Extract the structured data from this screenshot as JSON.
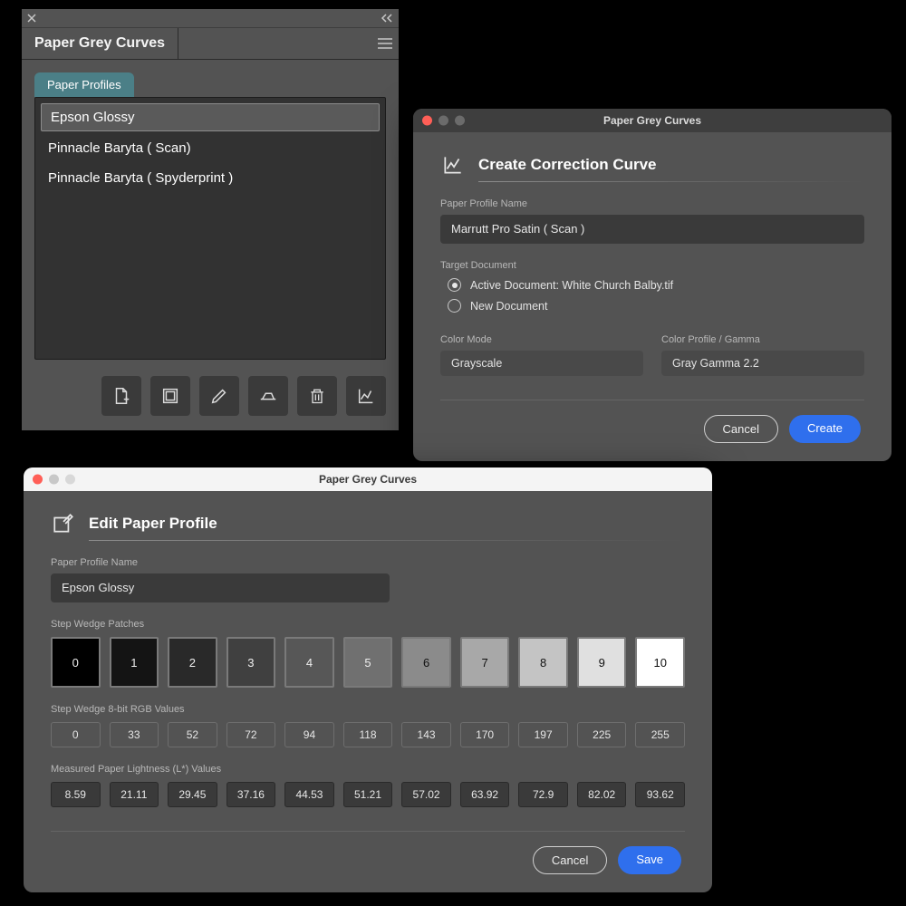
{
  "panel": {
    "title": "Paper Grey Curves",
    "tab_label": "Paper Profiles",
    "profiles": [
      "Epson Glossy",
      "Pinnacle Baryta ( Scan)",
      "Pinnacle Baryta ( Spyderprint )"
    ],
    "selected_index": 0
  },
  "create_dialog": {
    "window_title": "Paper Grey Curves",
    "heading": "Create Correction Curve",
    "profile_name_label": "Paper Profile Name",
    "profile_name_value": "Marrutt Pro Satin ( Scan )",
    "target_doc_label": "Target Document",
    "radio_active": "Active Document: White Church Balby.tif",
    "radio_new": "New Document",
    "color_mode_label": "Color Mode",
    "color_mode_value": "Grayscale",
    "color_profile_label": "Color Profile / Gamma",
    "color_profile_value": "Gray Gamma 2.2",
    "cancel_label": "Cancel",
    "create_label": "Create"
  },
  "edit_dialog": {
    "window_title": "Paper Grey Curves",
    "heading": "Edit Paper Profile",
    "profile_name_label": "Paper Profile Name",
    "profile_name_value": "Epson Glossy",
    "patches_label": "Step Wedge Patches",
    "patches": [
      {
        "label": "0",
        "bg": "#000000",
        "txt": "light"
      },
      {
        "label": "1",
        "bg": "#141414",
        "txt": "light"
      },
      {
        "label": "2",
        "bg": "#292929",
        "txt": "light"
      },
      {
        "label": "3",
        "bg": "#404040",
        "txt": "light"
      },
      {
        "label": "4",
        "bg": "#575757",
        "txt": "light"
      },
      {
        "label": "5",
        "bg": "#707070",
        "txt": "light"
      },
      {
        "label": "6",
        "bg": "#8b8b8b",
        "txt": "dark"
      },
      {
        "label": "7",
        "bg": "#a8a8a8",
        "txt": "dark"
      },
      {
        "label": "8",
        "bg": "#c4c4c4",
        "txt": "dark"
      },
      {
        "label": "9",
        "bg": "#e0e0e0",
        "txt": "dark"
      },
      {
        "label": "10",
        "bg": "#ffffff",
        "txt": "dark"
      }
    ],
    "rgb_label": "Step Wedge 8-bit RGB Values",
    "rgb_values": [
      "0",
      "33",
      "52",
      "72",
      "94",
      "118",
      "143",
      "170",
      "197",
      "225",
      "255"
    ],
    "lstar_label": "Measured Paper Lightness (L*) Values",
    "lstar_values": [
      "8.59",
      "21.11",
      "29.45",
      "37.16",
      "44.53",
      "51.21",
      "57.02",
      "63.92",
      "72.9",
      "82.02",
      "93.62"
    ],
    "cancel_label": "Cancel",
    "save_label": "Save"
  }
}
